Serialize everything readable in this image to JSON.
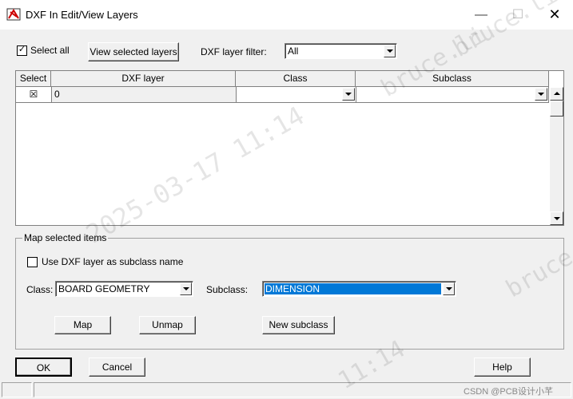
{
  "window": {
    "title": "DXF In Edit/View Layers",
    "controls": {
      "minimize": "—",
      "maximize": "☐",
      "close": "✕"
    }
  },
  "top": {
    "select_all_label": "Select all",
    "select_all_checked": true,
    "view_selected_label": "View selected layers",
    "filter_label": "DXF layer filter:",
    "filter_value": "All"
  },
  "grid": {
    "columns": [
      "Select",
      "DXF layer",
      "Class",
      "Subclass"
    ],
    "rows": [
      {
        "select": "☒",
        "layer": "0",
        "class": "",
        "subclass": ""
      }
    ]
  },
  "map": {
    "group_title": "Map selected items",
    "use_subclass_label": "Use DXF layer as subclass name",
    "use_subclass_checked": false,
    "class_label": "Class:",
    "class_value": "BOARD GEOMETRY",
    "subclass_label": "Subclass:",
    "subclass_value": "DIMENSION",
    "map_button": "Map",
    "unmap_button": "Unmap",
    "new_subclass_button": "New subclass"
  },
  "footer": {
    "ok": "OK",
    "cancel": "Cancel",
    "help": "Help"
  },
  "watermarks": [
    "bruce.li",
    "bruce.li",
    "2025-03-17 11:14",
    "bruce",
    "11:14"
  ],
  "credit": "CSDN @PCB设计小芊",
  "colors": {
    "selection": "#0078d7",
    "title_bg": "#ffffff",
    "dialog_bg": "#f0f0f0"
  }
}
